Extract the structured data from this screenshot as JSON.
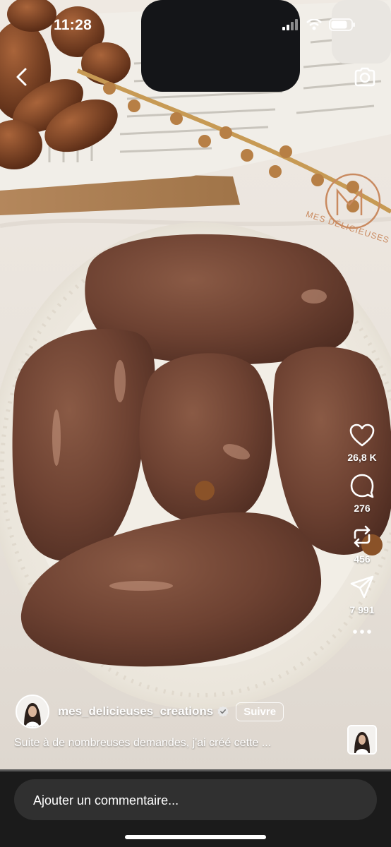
{
  "status_bar": {
    "time": "11:28",
    "battery_level": 0.8
  },
  "brand_watermark": {
    "text": "MES DÉLICIEUSES CRÉATIONS",
    "monogram": "MdC",
    "color": "#c98a60"
  },
  "actions": {
    "like": {
      "icon": "heart-icon",
      "count": "26,8 K"
    },
    "comment": {
      "icon": "comment-icon",
      "count": "276"
    },
    "repost": {
      "icon": "repost-icon",
      "count": "456"
    },
    "share": {
      "icon": "send-icon",
      "count": "7 991"
    },
    "more": {
      "icon": "more-icon"
    }
  },
  "author": {
    "username": "mes_delicieuses_creations",
    "verified": true,
    "follow_label": "Suivre"
  },
  "caption": "Suite à de nombreuses demandes, j'ai créé cette ...",
  "playback_progress": 0.0,
  "comment_box": {
    "placeholder": "Ajouter un commentaire..."
  }
}
